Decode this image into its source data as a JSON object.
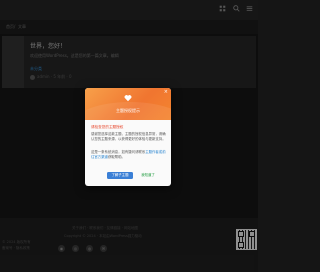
{
  "breadcrumb": {
    "home": "首页",
    "sep": "/",
    "current": "文章"
  },
  "post": {
    "title": "世界，您好！",
    "excerpt": "欢迎使用WordPress。这是您的第一篇文章。编辑",
    "tag": "未分类",
    "meta": "admin · 5 年前 · 0"
  },
  "modal": {
    "close": "×",
    "title": "主题授权提示",
    "notice_title": "请检查您的主题授权",
    "para1": "感谢您选择这款主题，主题的授权信息异常，请确认您的主题来源，以获得更好的体验与更新支持。",
    "para2_prefix": "这是一条系统消息，如有疑问请联系",
    "para2_link": "主题作者或前往官方渠道",
    "para2_suffix": "获取帮助。",
    "btn_learn": "了解子主题",
    "btn_know": "我知道了"
  },
  "footer": {
    "links": "关于我们 · 联系我们 · 友情链接 · 网站地图",
    "copyright": "Copyright © 2024 · 本站由WordPress强力驱动",
    "left1": "© 2024 版权所有",
    "left2": "备案号 · 隐私政策"
  },
  "icons": {
    "search": "search-icon",
    "user": "user-icon",
    "menu": "menu-icon"
  }
}
